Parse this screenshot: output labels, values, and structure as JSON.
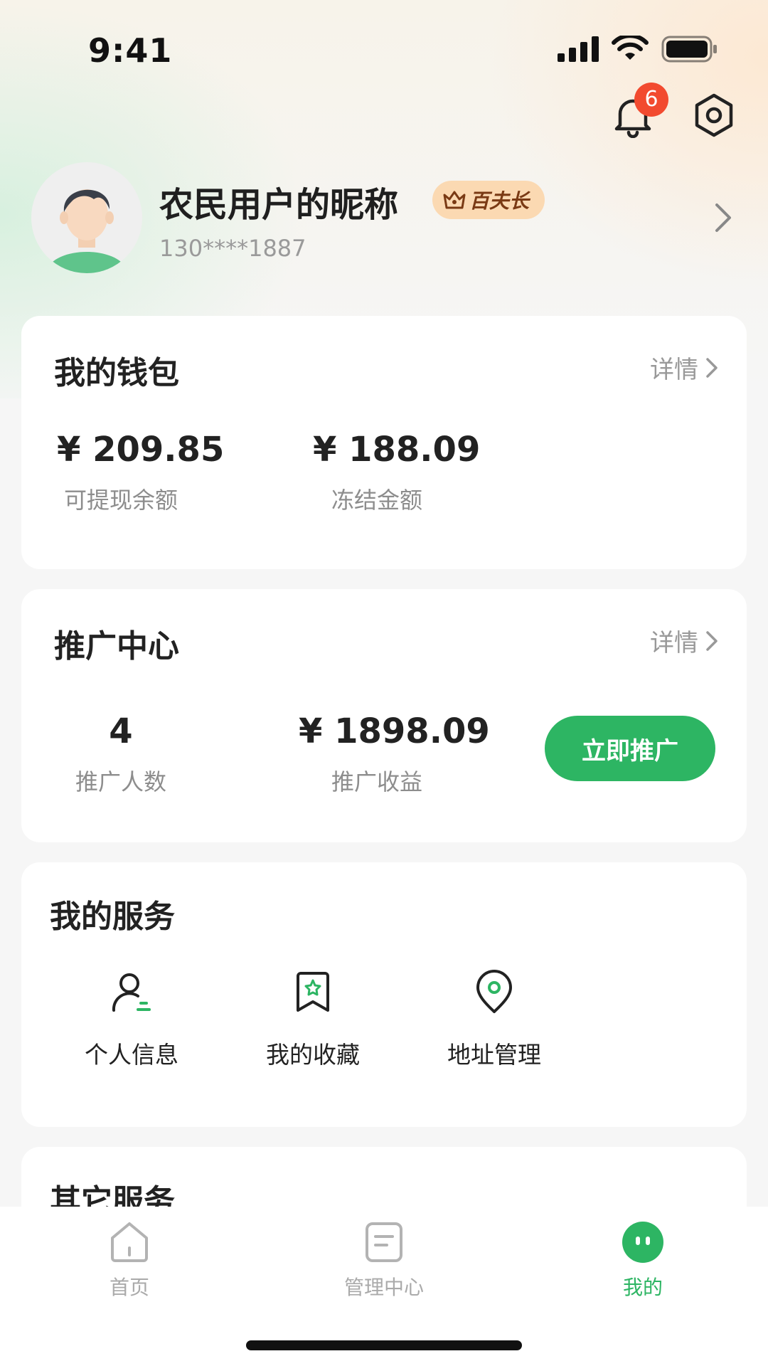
{
  "status_bar": {
    "time": "9:41"
  },
  "top_actions": {
    "notification_count": "6"
  },
  "profile": {
    "nickname": "农民用户的昵称",
    "level": "百夫长",
    "phone": "130****1887"
  },
  "wallet": {
    "title": "我的钱包",
    "detail_label": "详情",
    "withdrawable_value": "¥ 209.85",
    "withdrawable_label": "可提现余额",
    "frozen_value": "¥ 188.09",
    "frozen_label": "冻结金额"
  },
  "promotion": {
    "title": "推广中心",
    "detail_label": "详情",
    "count_value": "4",
    "count_label": "推广人数",
    "earnings_value": "¥ 1898.09",
    "earnings_label": "推广收益",
    "button_label": "立即推广"
  },
  "my_services": {
    "title": "我的服务",
    "items": [
      {
        "label": "个人信息",
        "icon": "user-info-icon"
      },
      {
        "label": "我的收藏",
        "icon": "favorites-icon"
      },
      {
        "label": "地址管理",
        "icon": "location-icon"
      }
    ]
  },
  "other_services": {
    "title": "其它服务"
  },
  "tabbar": {
    "items": [
      {
        "label": "首页",
        "icon": "home-icon",
        "active": false
      },
      {
        "label": "管理中心",
        "icon": "document-icon",
        "active": false
      },
      {
        "label": "我的",
        "icon": "profile-face-icon",
        "active": true
      }
    ]
  },
  "colors": {
    "accent_green": "#2db563",
    "badge_red": "#f24a2f",
    "level_badge_bg": "#fbd9b2",
    "level_badge_text": "#7a3a14"
  }
}
